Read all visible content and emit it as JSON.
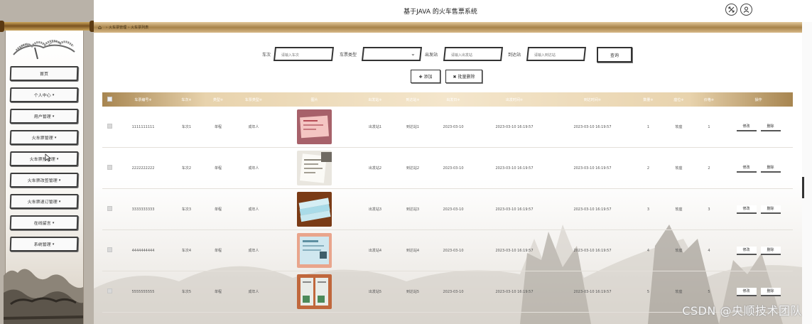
{
  "app": {
    "title": "基于JAVA 的火车售票系统"
  },
  "breadcrumb": [
    "火车票管理",
    "火车票列表"
  ],
  "sidebar": {
    "items": [
      {
        "label": "首页",
        "arrow": ""
      },
      {
        "label": "个人中心",
        "arrow": "▾"
      },
      {
        "label": "用户管理",
        "arrow": "▾"
      },
      {
        "label": "火车票管理",
        "arrow": "▾"
      },
      {
        "label": "火车票预管理",
        "arrow": "▾"
      },
      {
        "label": "火车票改签管理",
        "arrow": "▾"
      },
      {
        "label": "火车票退订管理",
        "arrow": "▾"
      },
      {
        "label": "在线留言",
        "arrow": "▾"
      },
      {
        "label": "系统管理",
        "arrow": "▾"
      }
    ]
  },
  "search": {
    "train_label": "车次",
    "train_placeholder": "请输入车次",
    "ticket_type_label": "车票类型",
    "ticket_type_value": "",
    "departure_label": "出发站",
    "departure_placeholder": "请输入出发站",
    "arrival_label": "到达站",
    "arrival_placeholder": "请输入到达站",
    "query_label": "查询"
  },
  "actions": {
    "add_label": "✚ 添加",
    "batch_delete_label": "✖ 批量删除"
  },
  "table": {
    "headers": [
      "车票编号≑",
      "车次≑",
      "类型≑",
      "车票类型≑",
      "图片",
      "出发站≑",
      "到达站≑",
      "出发日≑",
      "出发时间≑",
      "到达时间≑",
      "数量≑",
      "座位≑",
      "价格≑",
      "操作"
    ],
    "rows": [
      {
        "no": "1111111111",
        "train": "车次1",
        "type": "单程",
        "ptype": "成年人",
        "from": "出发站1",
        "to": "到达站1",
        "date": "2023-03-10",
        "dtime": "2023-03-10 16:19:57",
        "atime": "2023-03-10 16:19:57",
        "qty": "1",
        "seat": "软座",
        "price": "1",
        "edit": "修改",
        "del": "删除"
      },
      {
        "no": "2222222222",
        "train": "车次2",
        "type": "单程",
        "ptype": "成年人",
        "from": "出发站2",
        "to": "到达站2",
        "date": "2023-03-10",
        "dtime": "2023-03-10 16:19:57",
        "atime": "2023-03-10 16:19:57",
        "qty": "2",
        "seat": "软座",
        "price": "2",
        "edit": "修改",
        "del": "删除"
      },
      {
        "no": "3333333333",
        "train": "车次3",
        "type": "单程",
        "ptype": "成年人",
        "from": "出发站3",
        "to": "到达站3",
        "date": "2023-03-10",
        "dtime": "2023-03-10 16:19:57",
        "atime": "2023-03-10 16:19:57",
        "qty": "3",
        "seat": "软座",
        "price": "3",
        "edit": "修改",
        "del": "删除"
      },
      {
        "no": "4444444444",
        "train": "车次4",
        "type": "单程",
        "ptype": "成年人",
        "from": "出发站4",
        "to": "到达站4",
        "date": "2023-03-10",
        "dtime": "2023-03-10 16:19:57",
        "atime": "2023-03-10 16:19:57",
        "qty": "4",
        "seat": "软座",
        "price": "4",
        "edit": "修改",
        "del": "删除"
      },
      {
        "no": "5555555555",
        "train": "车次5",
        "type": "单程",
        "ptype": "成年人",
        "from": "出发站5",
        "to": "到达站5",
        "date": "2023-03-10",
        "dtime": "2023-03-10 16:19:57",
        "atime": "2023-03-10 16:19:57",
        "qty": "5",
        "seat": "软座",
        "price": "5",
        "edit": "修改",
        "del": "删除"
      }
    ]
  },
  "watermark": "CSDN @央顺技术团队",
  "colors": {
    "accent_gold": "#b8955c",
    "header_gradient_edge": "#a78550",
    "border_dark": "#333333"
  }
}
